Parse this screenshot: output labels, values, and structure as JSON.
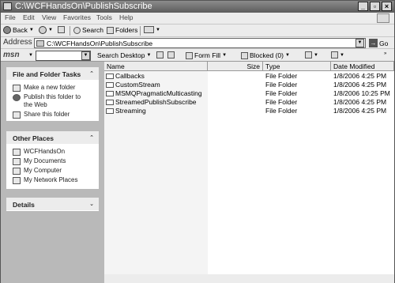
{
  "window": {
    "title": "C:\\WCFHandsOn\\PublishSubscribe"
  },
  "menu": [
    "File",
    "Edit",
    "View",
    "Favorites",
    "Tools",
    "Help"
  ],
  "toolbar": {
    "back": "Back",
    "search": "Search",
    "folders": "Folders"
  },
  "address": {
    "label": "Address",
    "value": "C:\\WCFHandsOn\\PublishSubscribe",
    "go": "Go"
  },
  "msn": {
    "logo": "msn",
    "search_desktop": "Search Desktop",
    "form_fill": "Form Fill",
    "blocked": "Blocked (0)"
  },
  "left": {
    "file_tasks": {
      "title": "File and Folder Tasks",
      "items": [
        "Make a new folder",
        "Publish this folder to the Web",
        "Share this folder"
      ]
    },
    "other_places": {
      "title": "Other Places",
      "items": [
        "WCFHandsOn",
        "My Documents",
        "My Computer",
        "My Network Places"
      ]
    },
    "details": {
      "title": "Details"
    }
  },
  "columns": {
    "name": "Name",
    "size": "Size",
    "type": "Type",
    "date": "Date Modified"
  },
  "files": [
    {
      "name": "Callbacks",
      "type": "File Folder",
      "date": "1/8/2006 4:25 PM"
    },
    {
      "name": "CustomStream",
      "type": "File Folder",
      "date": "1/8/2006 4:25 PM"
    },
    {
      "name": "MSMQPragmaticMulticasting",
      "type": "File Folder",
      "date": "1/8/2006 10:25 PM"
    },
    {
      "name": "StreamedPublishSubscribe",
      "type": "File Folder",
      "date": "1/8/2006 4:25 PM"
    },
    {
      "name": "Streaming",
      "type": "File Folder",
      "date": "1/8/2006 4:25 PM"
    }
  ]
}
